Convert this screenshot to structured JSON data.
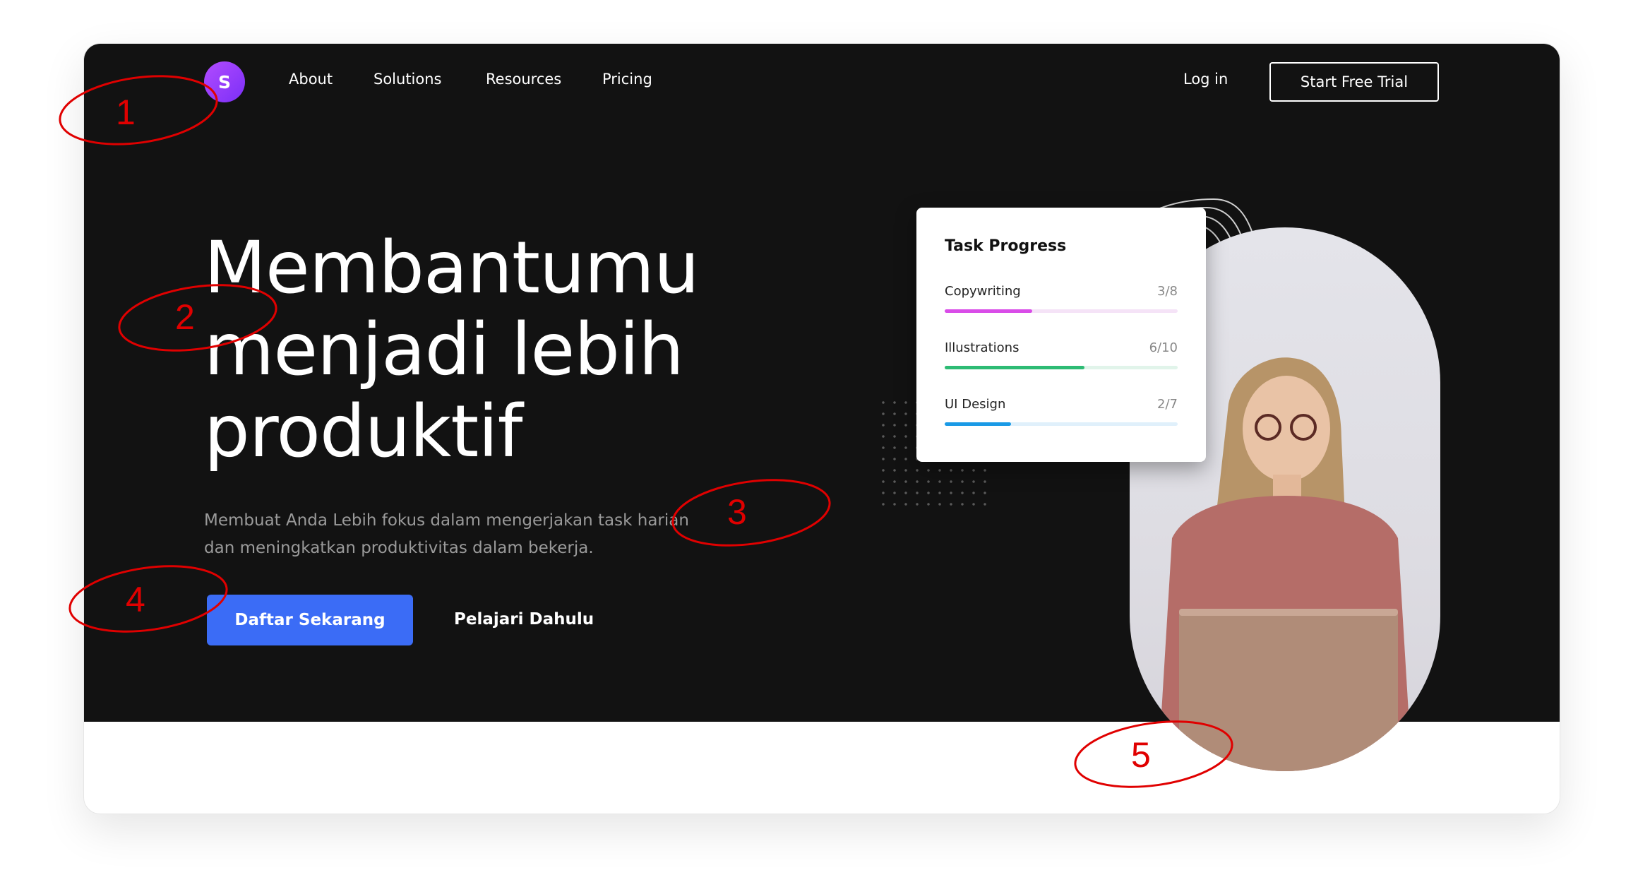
{
  "nav": {
    "logo_letter": "S",
    "items": [
      "About",
      "Solutions",
      "Resources",
      "Pricing"
    ],
    "login": "Log in",
    "cta": "Start Free Trial"
  },
  "hero": {
    "headline_lines": [
      "Membantumu",
      "menjadi lebih",
      "produktif"
    ],
    "subtitle_lines": [
      "Membuat Anda Lebih fokus dalam mengerjakan task harian",
      "dan meningkatkan produktivitas dalam bekerja."
    ],
    "primary_button": "Daftar Sekarang",
    "secondary_button": "Pelajari Dahulu"
  },
  "task_progress": {
    "title": "Task Progress",
    "tasks": [
      {
        "name": "Copywriting",
        "count": "3/8",
        "done": 3,
        "total": 8,
        "color": "#d94ce8",
        "track": "#f5e3f7"
      },
      {
        "name": "Illustrations",
        "count": "6/10",
        "done": 6,
        "total": 10,
        "color": "#2dbb74",
        "track": "#e1f4ea"
      },
      {
        "name": "UI Design",
        "count": "2/7",
        "done": 2,
        "total": 7,
        "color": "#1a9ae6",
        "track": "#e0f0fb"
      }
    ]
  },
  "annotations": [
    "1",
    "2",
    "3",
    "4",
    "5"
  ],
  "colors": {
    "hero_bg": "#121212",
    "primary": "#3b6cf6",
    "logo_gradient_start": "#b24cff",
    "logo_gradient_end": "#7b2ff7",
    "annotation": "#e00000"
  }
}
